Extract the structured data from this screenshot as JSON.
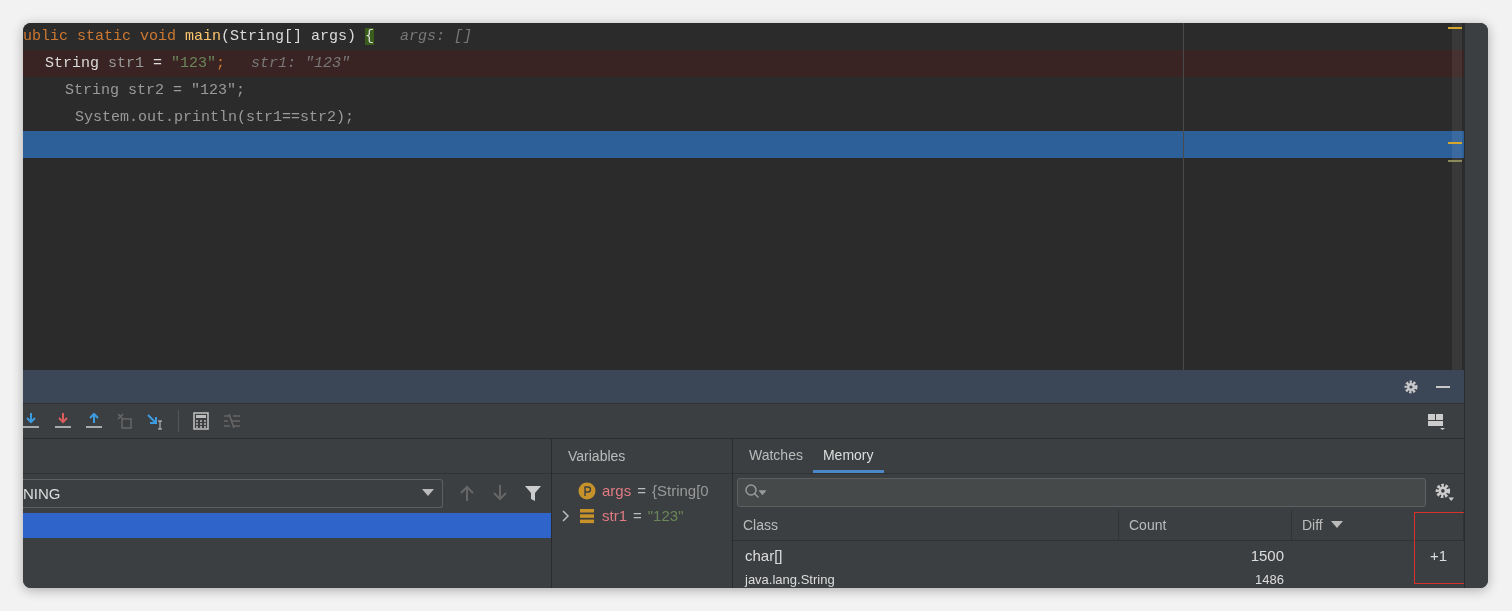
{
  "editor": {
    "lines": [
      {
        "kind": "normal",
        "tokens": [
          {
            "text": "ublic static void ",
            "kind": "keyword"
          },
          {
            "text": "main",
            "kind": "method"
          },
          {
            "text": "(String[] args) ",
            "kind": "plain"
          },
          {
            "text": "{",
            "kind": "brace"
          }
        ],
        "hint": "args: []"
      },
      {
        "kind": "breakpoint",
        "tokens": [
          {
            "text": "String ",
            "kind": "plain"
          },
          {
            "text": "str1",
            "kind": "dim"
          },
          {
            "text": " = ",
            "kind": "plain"
          },
          {
            "text": "\"123\"",
            "kind": "string"
          },
          {
            "text": ";",
            "kind": "keyword"
          }
        ],
        "hint": "str1: \"123\""
      },
      {
        "kind": "normal",
        "tokens": [
          {
            "text": "String str2 = \"123\";",
            "kind": "dim"
          }
        ]
      },
      {
        "kind": "normal",
        "tokens": [
          {
            "text": "System.out.println(str1==str2);",
            "kind": "dim"
          }
        ]
      },
      {
        "kind": "execution"
      }
    ]
  },
  "frames": {
    "dropdown": "NING",
    "rows": [
      {
        "selected": true
      }
    ]
  },
  "variables": {
    "title": "Variables",
    "items": [
      {
        "kind": "parameter",
        "expandable": false,
        "name": "args",
        "operator": "=",
        "value": "{String[0"
      },
      {
        "kind": "field",
        "expandable": true,
        "name": "str1",
        "operator": "=",
        "value": "\"123\""
      }
    ]
  },
  "tabs": [
    {
      "label": "Watches",
      "selected": false
    },
    {
      "label": "Memory",
      "selected": true
    }
  ],
  "memory": {
    "diff_highlighted": true,
    "columns": [
      {
        "label": "Class",
        "sorted": false
      },
      {
        "label": "Count",
        "sorted": false
      },
      {
        "label": "Diff",
        "sorted": true
      }
    ],
    "rows": [
      {
        "class": "char[]",
        "count": "1500",
        "diff": "+1"
      },
      {
        "class": "java.lang.String",
        "count": "1486"
      }
    ]
  }
}
